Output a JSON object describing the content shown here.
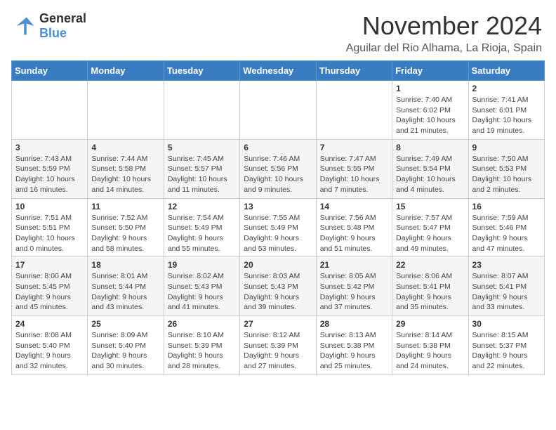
{
  "header": {
    "logo_general": "General",
    "logo_blue": "Blue",
    "month_title": "November 2024",
    "location": "Aguilar del Rio Alhama, La Rioja, Spain"
  },
  "days_of_week": [
    "Sunday",
    "Monday",
    "Tuesday",
    "Wednesday",
    "Thursday",
    "Friday",
    "Saturday"
  ],
  "weeks": [
    [
      {
        "day": "",
        "info": ""
      },
      {
        "day": "",
        "info": ""
      },
      {
        "day": "",
        "info": ""
      },
      {
        "day": "",
        "info": ""
      },
      {
        "day": "",
        "info": ""
      },
      {
        "day": "1",
        "info": "Sunrise: 7:40 AM\nSunset: 6:02 PM\nDaylight: 10 hours and 21 minutes."
      },
      {
        "day": "2",
        "info": "Sunrise: 7:41 AM\nSunset: 6:01 PM\nDaylight: 10 hours and 19 minutes."
      }
    ],
    [
      {
        "day": "3",
        "info": "Sunrise: 7:43 AM\nSunset: 5:59 PM\nDaylight: 10 hours and 16 minutes."
      },
      {
        "day": "4",
        "info": "Sunrise: 7:44 AM\nSunset: 5:58 PM\nDaylight: 10 hours and 14 minutes."
      },
      {
        "day": "5",
        "info": "Sunrise: 7:45 AM\nSunset: 5:57 PM\nDaylight: 10 hours and 11 minutes."
      },
      {
        "day": "6",
        "info": "Sunrise: 7:46 AM\nSunset: 5:56 PM\nDaylight: 10 hours and 9 minutes."
      },
      {
        "day": "7",
        "info": "Sunrise: 7:47 AM\nSunset: 5:55 PM\nDaylight: 10 hours and 7 minutes."
      },
      {
        "day": "8",
        "info": "Sunrise: 7:49 AM\nSunset: 5:54 PM\nDaylight: 10 hours and 4 minutes."
      },
      {
        "day": "9",
        "info": "Sunrise: 7:50 AM\nSunset: 5:53 PM\nDaylight: 10 hours and 2 minutes."
      }
    ],
    [
      {
        "day": "10",
        "info": "Sunrise: 7:51 AM\nSunset: 5:51 PM\nDaylight: 10 hours and 0 minutes."
      },
      {
        "day": "11",
        "info": "Sunrise: 7:52 AM\nSunset: 5:50 PM\nDaylight: 9 hours and 58 minutes."
      },
      {
        "day": "12",
        "info": "Sunrise: 7:54 AM\nSunset: 5:49 PM\nDaylight: 9 hours and 55 minutes."
      },
      {
        "day": "13",
        "info": "Sunrise: 7:55 AM\nSunset: 5:49 PM\nDaylight: 9 hours and 53 minutes."
      },
      {
        "day": "14",
        "info": "Sunrise: 7:56 AM\nSunset: 5:48 PM\nDaylight: 9 hours and 51 minutes."
      },
      {
        "day": "15",
        "info": "Sunrise: 7:57 AM\nSunset: 5:47 PM\nDaylight: 9 hours and 49 minutes."
      },
      {
        "day": "16",
        "info": "Sunrise: 7:59 AM\nSunset: 5:46 PM\nDaylight: 9 hours and 47 minutes."
      }
    ],
    [
      {
        "day": "17",
        "info": "Sunrise: 8:00 AM\nSunset: 5:45 PM\nDaylight: 9 hours and 45 minutes."
      },
      {
        "day": "18",
        "info": "Sunrise: 8:01 AM\nSunset: 5:44 PM\nDaylight: 9 hours and 43 minutes."
      },
      {
        "day": "19",
        "info": "Sunrise: 8:02 AM\nSunset: 5:43 PM\nDaylight: 9 hours and 41 minutes."
      },
      {
        "day": "20",
        "info": "Sunrise: 8:03 AM\nSunset: 5:43 PM\nDaylight: 9 hours and 39 minutes."
      },
      {
        "day": "21",
        "info": "Sunrise: 8:05 AM\nSunset: 5:42 PM\nDaylight: 9 hours and 37 minutes."
      },
      {
        "day": "22",
        "info": "Sunrise: 8:06 AM\nSunset: 5:41 PM\nDaylight: 9 hours and 35 minutes."
      },
      {
        "day": "23",
        "info": "Sunrise: 8:07 AM\nSunset: 5:41 PM\nDaylight: 9 hours and 33 minutes."
      }
    ],
    [
      {
        "day": "24",
        "info": "Sunrise: 8:08 AM\nSunset: 5:40 PM\nDaylight: 9 hours and 32 minutes."
      },
      {
        "day": "25",
        "info": "Sunrise: 8:09 AM\nSunset: 5:40 PM\nDaylight: 9 hours and 30 minutes."
      },
      {
        "day": "26",
        "info": "Sunrise: 8:10 AM\nSunset: 5:39 PM\nDaylight: 9 hours and 28 minutes."
      },
      {
        "day": "27",
        "info": "Sunrise: 8:12 AM\nSunset: 5:39 PM\nDaylight: 9 hours and 27 minutes."
      },
      {
        "day": "28",
        "info": "Sunrise: 8:13 AM\nSunset: 5:38 PM\nDaylight: 9 hours and 25 minutes."
      },
      {
        "day": "29",
        "info": "Sunrise: 8:14 AM\nSunset: 5:38 PM\nDaylight: 9 hours and 24 minutes."
      },
      {
        "day": "30",
        "info": "Sunrise: 8:15 AM\nSunset: 5:37 PM\nDaylight: 9 hours and 22 minutes."
      }
    ]
  ]
}
